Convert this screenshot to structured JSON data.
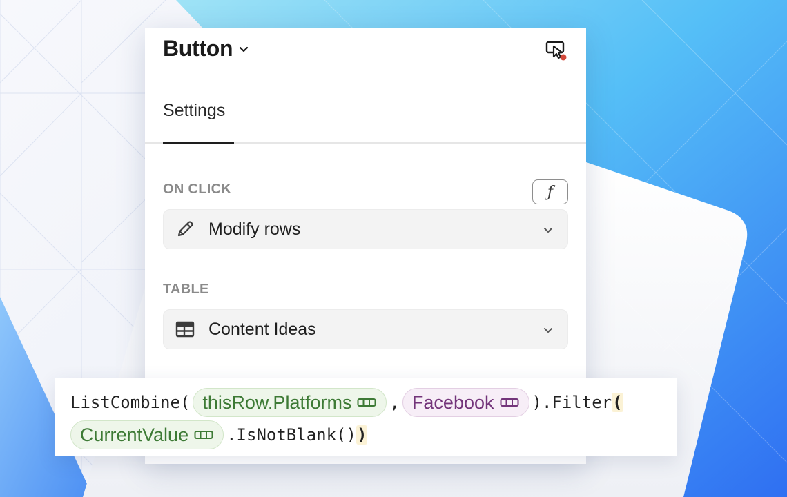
{
  "panel": {
    "title": "Button",
    "tabs": [
      {
        "label": "Settings",
        "active": true
      }
    ],
    "on_click": {
      "label": "ON CLICK",
      "formula_button": "ƒ",
      "selected": "Modify rows",
      "icon": "pencil-icon"
    },
    "table": {
      "label": "TABLE",
      "selected": "Content Ideas",
      "icon": "table-icon"
    }
  },
  "formula": {
    "line1": {
      "prefix": "ListCombine(",
      "chip1": {
        "text": "thisRow.Platforms",
        "color": "#3d7a35",
        "icon": "column-icon"
      },
      "comma": ",",
      "chip2": {
        "text": "Facebook",
        "color": "#73347a",
        "icon": "column-icon"
      },
      "middle": ").Filter",
      "open_paren": "("
    },
    "line2": {
      "chip": {
        "text": "CurrentValue",
        "color": "#3d7a35",
        "icon": "column-icon"
      },
      "call": ".IsNotBlank(",
      "close_inner": ")",
      "close_outer": ")"
    }
  },
  "colors": {
    "accent_blue": "#3f8cf7",
    "status_dot": "#d2483a",
    "highlight_paren": "#fbf2d5"
  }
}
